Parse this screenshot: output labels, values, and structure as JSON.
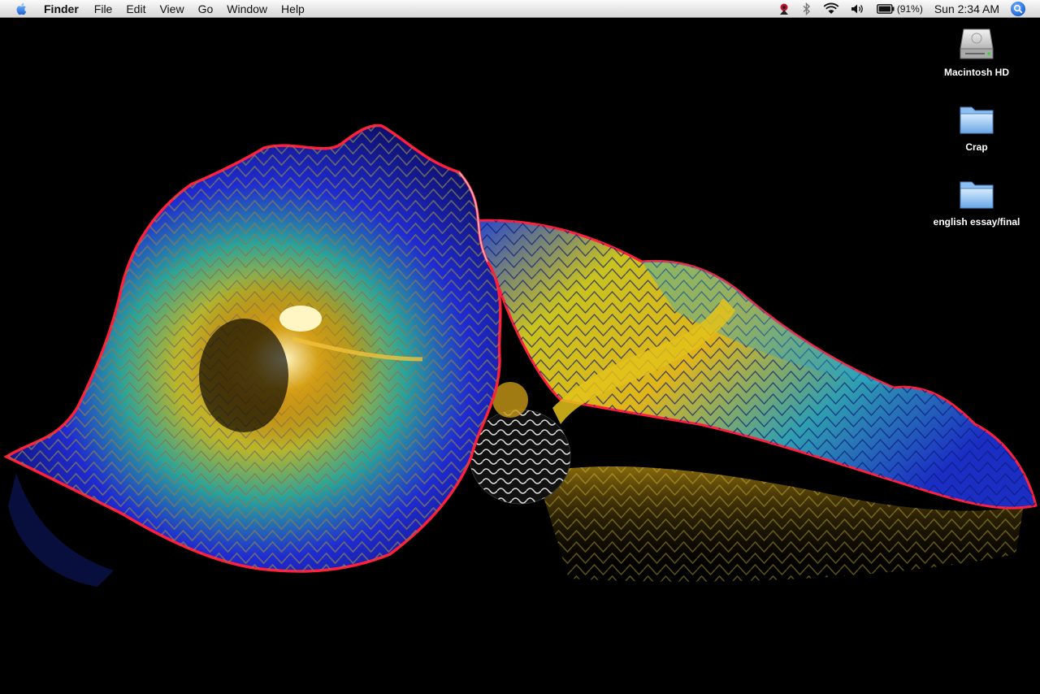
{
  "menubar": {
    "app_name": "Finder",
    "items": [
      "File",
      "Edit",
      "View",
      "Go",
      "Window",
      "Help"
    ],
    "status": {
      "battery_percent": "(91%)",
      "clock": "Sun 2:34 AM",
      "icons": [
        "extra-menu-icon",
        "bluetooth-icon",
        "wifi-icon",
        "volume-icon",
        "battery-icon",
        "spotlight-icon"
      ]
    }
  },
  "desktop": {
    "icons": [
      {
        "label": "Macintosh HD",
        "type": "hard-drive"
      },
      {
        "label": "Crap",
        "type": "folder"
      },
      {
        "label": "english essay/final",
        "type": "folder"
      }
    ]
  },
  "colors": {
    "background": "#000000",
    "wallpaper_blue": "#1f2bd0",
    "wallpaper_yellow": "#d8c21c",
    "wallpaper_rim": "#ff2040"
  }
}
